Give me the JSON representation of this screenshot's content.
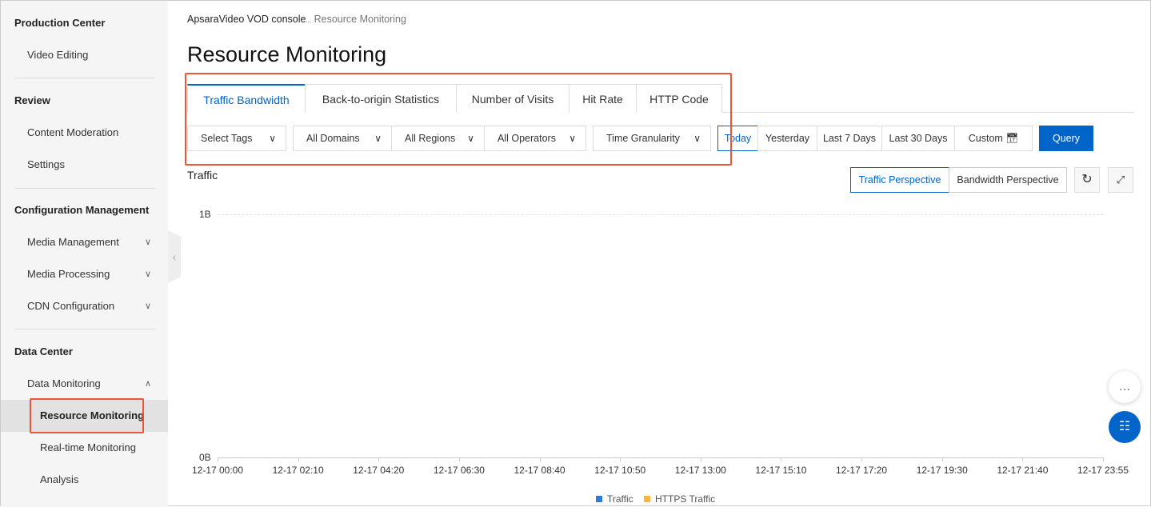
{
  "sidebar": {
    "sections": [
      {
        "title": "Production Center",
        "items": [
          "Video Editing"
        ]
      },
      {
        "title": "Review",
        "items": [
          "Content Moderation",
          "Settings"
        ]
      },
      {
        "title": "Configuration Management",
        "items": [
          "Media Management",
          "Media Processing",
          "CDN Configuration"
        ]
      },
      {
        "title": "Data Center",
        "items": [
          "Data Monitoring"
        ],
        "subitems": [
          "Resource Monitoring",
          "Real-time Monitoring",
          "Analysis"
        ]
      }
    ],
    "active": "Resource Monitoring"
  },
  "breadcrumb": {
    "root": "ApsaraVideo VOD console",
    "sep": "...",
    "current": "Resource Monitoring"
  },
  "page_title": "Resource Monitoring",
  "tabs": [
    "Traffic Bandwidth",
    "Back-to-origin Statistics",
    "Number of Visits",
    "Hit Rate",
    "HTTP Code"
  ],
  "active_tab": "Traffic Bandwidth",
  "filters": {
    "tags": "Select Tags",
    "domains": "All Domains",
    "regions": "All Regions",
    "operators": "All Operators",
    "granularity": "Time Granularity"
  },
  "time_ranges": [
    "Today",
    "Yesterday",
    "Last 7 Days",
    "Last 30 Days",
    "Custom"
  ],
  "active_range": "Today",
  "query_label": "Query",
  "perspectives": [
    "Traffic Perspective",
    "Bandwidth Perspective"
  ],
  "active_perspective": "Traffic Perspective",
  "colors": {
    "primary": "#0064c8",
    "highlight": "#e8573a",
    "traffic": "#2f7bd6",
    "https": "#f5b83d"
  },
  "chart_data": {
    "type": "line",
    "title": "Traffic",
    "y_ticks": [
      "0B",
      "1B"
    ],
    "ylim": [
      0,
      1
    ],
    "x_ticks": [
      "12-17 00:00",
      "12-17 02:10",
      "12-17 04:20",
      "12-17 06:30",
      "12-17 08:40",
      "12-17 10:50",
      "12-17 13:00",
      "12-17 15:10",
      "12-17 17:20",
      "12-17 19:30",
      "12-17 21:40",
      "12-17 23:55"
    ],
    "series": [
      {
        "name": "Traffic",
        "values": []
      },
      {
        "name": "HTTPS Traffic",
        "values": []
      }
    ],
    "legend": "bottom",
    "grid": true
  }
}
